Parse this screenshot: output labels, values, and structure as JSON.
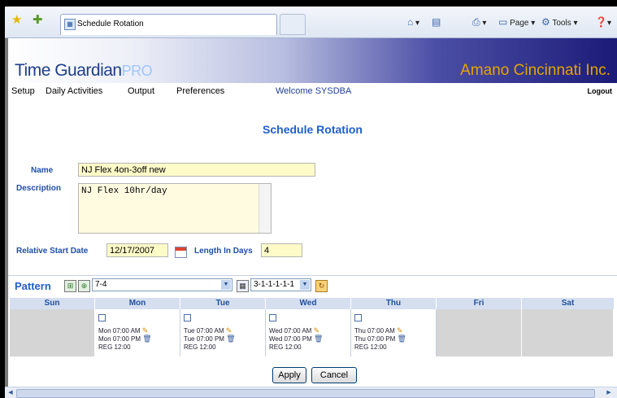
{
  "browser": {
    "tab_title": "Schedule Rotation",
    "commands": [
      {
        "icon": "home-icon",
        "label": ""
      },
      {
        "icon": "feeds-icon",
        "label": ""
      },
      {
        "icon": "print-icon",
        "label": ""
      },
      {
        "icon": "page-icon",
        "label": "Page"
      },
      {
        "icon": "tools-icon",
        "label": "Tools"
      },
      {
        "icon": "help-icon",
        "label": ""
      }
    ]
  },
  "app": {
    "logo_main": "Time Guardian",
    "logo_pro": "PRO",
    "company": "Amano Cincinnati Inc.",
    "menu": [
      "Setup",
      "Daily Activities",
      "Output",
      "Preferences"
    ],
    "welcome": "Welcome SYSDBA",
    "logout": "Logout"
  },
  "form": {
    "title": "Schedule Rotation",
    "name_label": "Name",
    "name_value": "NJ Flex 4on-3off new",
    "description_label": "Description",
    "description_value": "NJ Flex 10hr/day",
    "start_label": "Relative Start Date",
    "start_value": "12/17/2007",
    "length_label": "Length In Days",
    "length_value": "4"
  },
  "pattern": {
    "title": "Pattern",
    "selected": "7-4",
    "sequence": "3-1-1-1-1-1",
    "days": [
      {
        "header": "Sun",
        "work": false
      },
      {
        "header": "Mon",
        "work": true,
        "in": "Mon 07:00 AM",
        "out": "Mon 07:00 PM",
        "reg": "REG 12:00"
      },
      {
        "header": "Tue",
        "work": true,
        "in": "Tue 07:00 AM",
        "out": "Tue 07:00 PM",
        "reg": "REG 12:00"
      },
      {
        "header": "Wed",
        "work": true,
        "in": "Wed 07:00 AM",
        "out": "Wed 07:00 PM",
        "reg": "REG 12:00"
      },
      {
        "header": "Thu",
        "work": true,
        "in": "Thu 07:00 AM",
        "out": "Thu 07:00 PM",
        "reg": "REG 12:00"
      },
      {
        "header": "Fri",
        "work": false
      },
      {
        "header": "Sat",
        "work": false
      }
    ]
  },
  "buttons": {
    "apply": "Apply",
    "cancel": "Cancel"
  }
}
